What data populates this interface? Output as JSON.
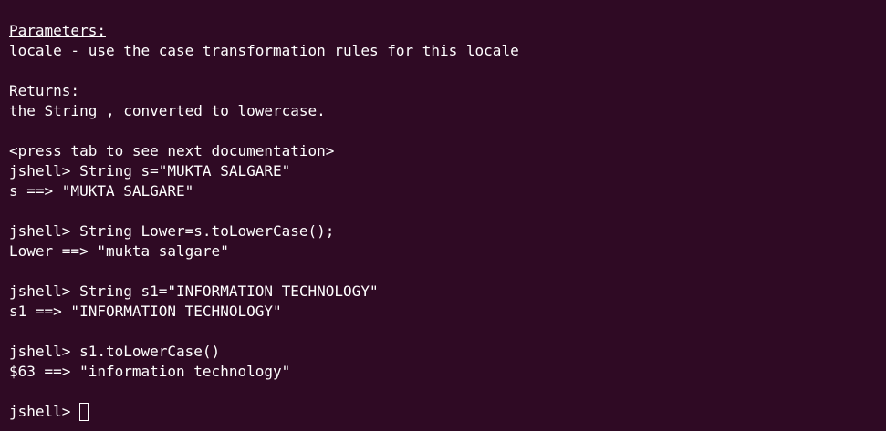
{
  "terminal": {
    "doc": {
      "params_heading": "Parameters:",
      "params_text": "locale - use the case transformation rules for this locale",
      "returns_heading": "Returns:",
      "returns_text": "the String , converted to lowercase.",
      "press_tab": "<press tab to see next documentation>"
    },
    "lines": [
      "jshell> String s=\"MUKTA SALGARE\"",
      "s ==> \"MUKTA SALGARE\"",
      "",
      "jshell> String Lower=s.toLowerCase();",
      "Lower ==> \"mukta salgare\"",
      "",
      "jshell> String s1=\"INFORMATION TECHNOLOGY\"",
      "s1 ==> \"INFORMATION TECHNOLOGY\"",
      "",
      "jshell> s1.toLowerCase()",
      "$63 ==> \"information technology\"",
      ""
    ],
    "prompt": "jshell> "
  }
}
